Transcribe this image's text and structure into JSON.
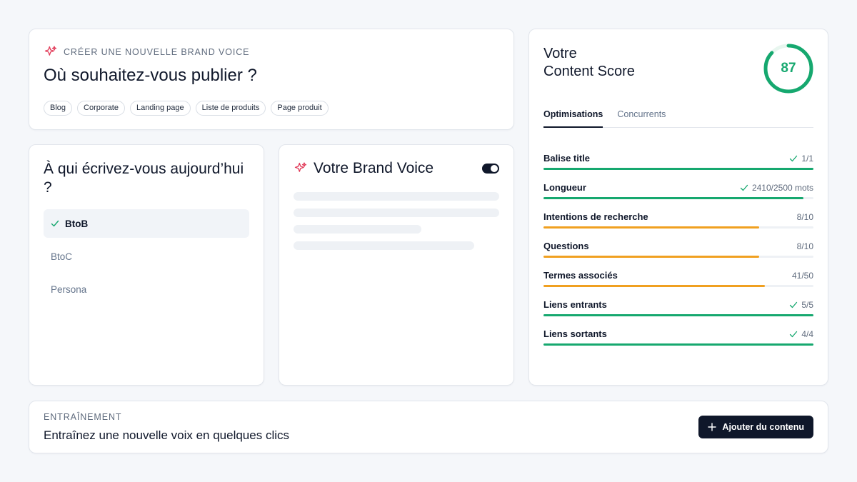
{
  "colors": {
    "accent": "#e23d5b",
    "success": "#16a86f",
    "warning": "#f0a020",
    "dark": "#0f172a"
  },
  "publish": {
    "eyebrow": "Créer une nouvelle Brand Voice",
    "eyebrow_icon": "sparkle-icon",
    "title": "Où souhaitez-vous publier ?",
    "chips": [
      "Blog",
      "Corporate",
      "Landing page",
      "Liste de produits",
      "Page produit"
    ]
  },
  "audience": {
    "title": "À qui écrivez-vous aujourd’hui ?",
    "options": [
      {
        "label": "BtoB",
        "selected": true
      },
      {
        "label": "BtoC",
        "selected": false
      },
      {
        "label": "Persona",
        "selected": false
      }
    ]
  },
  "brand": {
    "title": "Votre Brand Voice",
    "icon": "sparkle-icon",
    "toggle_on": true
  },
  "score": {
    "title_line1": "Votre",
    "title_line2": "Content Score",
    "value": "87",
    "percent": 87,
    "tabs": [
      {
        "label": "Optimisations",
        "active": true
      },
      {
        "label": "Concurrents",
        "active": false
      }
    ],
    "metrics": [
      {
        "label": "Balise title",
        "value": "1/1",
        "check": true,
        "progress": 1.0,
        "status": "success"
      },
      {
        "label": "Longueur",
        "value": "2410/2500 mots",
        "check": true,
        "progress": 0.964,
        "status": "success"
      },
      {
        "label": "Intentions de recherche",
        "value": "8/10",
        "check": false,
        "progress": 0.8,
        "status": "warning"
      },
      {
        "label": "Questions",
        "value": "8/10",
        "check": false,
        "progress": 0.8,
        "status": "warning"
      },
      {
        "label": "Termes associés",
        "value": "41/50",
        "check": false,
        "progress": 0.82,
        "status": "warning"
      },
      {
        "label": "Liens entrants",
        "value": "5/5",
        "check": true,
        "progress": 1.0,
        "status": "success"
      },
      {
        "label": "Liens sortants",
        "value": "4/4",
        "check": true,
        "progress": 1.0,
        "status": "success"
      }
    ]
  },
  "training": {
    "eyebrow": "Entraînement",
    "title": "Entraînez une nouvelle voix en quelques clics",
    "button_label": "Ajouter du contenu",
    "button_icon": "plus-icon"
  }
}
